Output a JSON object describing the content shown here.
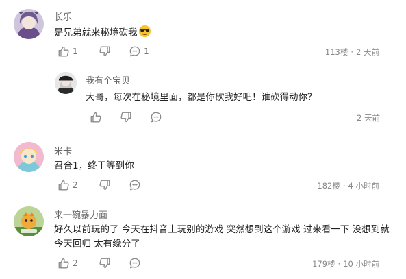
{
  "comments": [
    {
      "username": "长乐",
      "text": "是兄弟就来秘境砍我",
      "emoji": "sunglasses-emoji",
      "likes": "1",
      "replies": "1",
      "floor": "113楼",
      "time": "2 天前"
    },
    {
      "username": "我有个宝贝",
      "text": "大哥，每次在秘境里面，都是你砍我好吧！谁砍得动你？",
      "time": "2 天前"
    },
    {
      "username": "米卡",
      "text": "召合1，终于等到你",
      "likes": "2",
      "floor": "182楼",
      "time": "4 小时前"
    },
    {
      "username": "来一碗暴力面",
      "text": "好久以前玩的了  今天在抖音上玩别的游戏 突然想到这个游戏 过来看一下  没想到就今天回归 太有缘分了",
      "likes": "2",
      "floor": "179楼",
      "time": "10 小时前"
    }
  ],
  "meta_separator": "·",
  "colors": {
    "icon": "#8a8a8a",
    "text": "#222222",
    "username": "#666666",
    "meta": "#888888"
  }
}
